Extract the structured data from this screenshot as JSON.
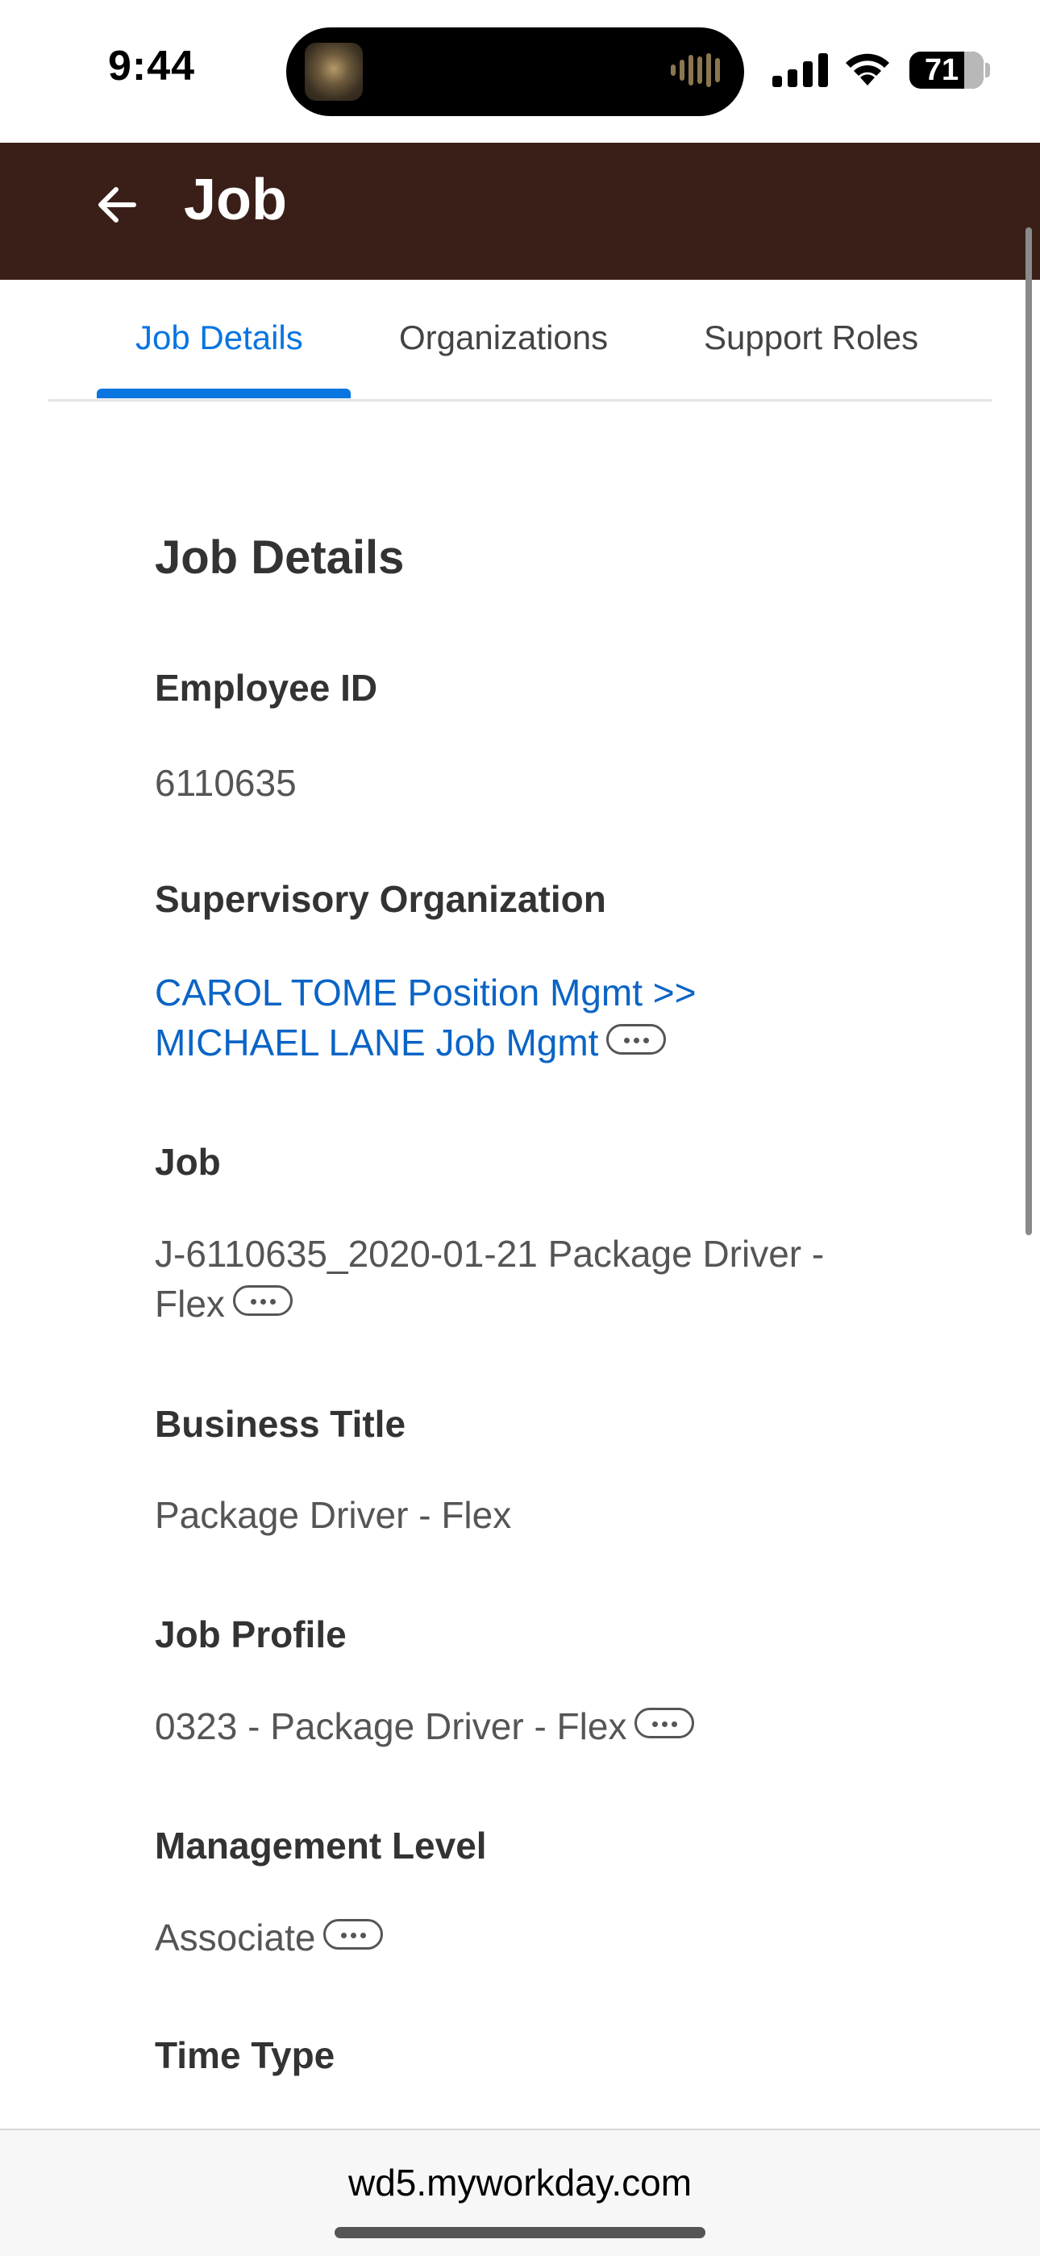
{
  "status_bar": {
    "time": "9:44",
    "battery": "71"
  },
  "header": {
    "title": "Job"
  },
  "tabs": [
    {
      "label": "Job Details",
      "active": true
    },
    {
      "label": "Organizations",
      "active": false
    },
    {
      "label": "Support Roles",
      "active": false
    }
  ],
  "section": {
    "title": "Job Details"
  },
  "fields": {
    "employee_id": {
      "label": "Employee ID",
      "value": "6110635"
    },
    "supervisory_org": {
      "label": "Supervisory Organization",
      "value_line1": "CAROL TOME Position Mgmt >>",
      "value_line2": "MICHAEL LANE Job Mgmt"
    },
    "job": {
      "label": "Job",
      "value_line1": "J-6110635_2020-01-21 Package Driver -",
      "value_line2": "Flex"
    },
    "business_title": {
      "label": "Business Title",
      "value": "Package Driver - Flex"
    },
    "job_profile": {
      "label": "Job Profile",
      "value": "0323 - Package Driver - Flex"
    },
    "management_level": {
      "label": "Management Level",
      "value": "Associate"
    },
    "time_type": {
      "label": "Time Type"
    }
  },
  "browser": {
    "url": "wd5.myworkday.com"
  },
  "colors": {
    "header_bg": "#3a1f19",
    "accent": "#0875e1",
    "link": "#0b64c5"
  }
}
